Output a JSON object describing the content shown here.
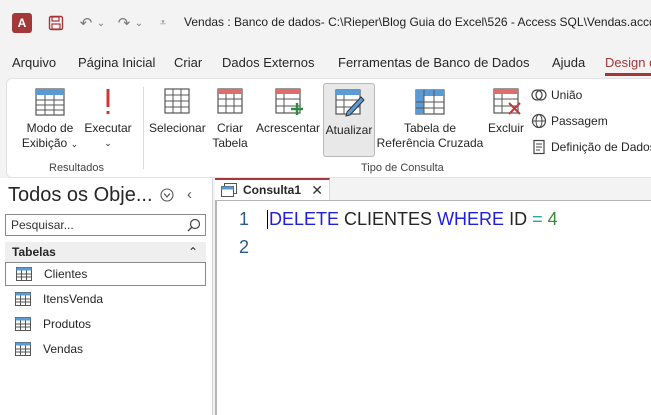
{
  "window": {
    "title": "Vendas : Banco de dados- C:\\Rieper\\Blog Guia do Excel\\526 - Access SQL\\Vendas.accdb (",
    "app_icon_letter": "A"
  },
  "ribbon_tabs": [
    "Arquivo",
    "Página Inicial",
    "Criar",
    "Dados Externos",
    "Ferramentas de Banco de Dados",
    "Ajuda",
    "Design d"
  ],
  "ribbon": {
    "results": {
      "view_line1": "Modo de",
      "view_line2": "Exibição",
      "run_line1": "Executar",
      "group": "Resultados"
    },
    "query_type": {
      "select": "Selecionar",
      "make_table_line1": "Criar",
      "make_table_line2": "Tabela",
      "append": "Acrescentar",
      "update": "Atualizar",
      "crosstab_line1": "Tabela de",
      "crosstab_line2": "Referência Cruzada",
      "delete": "Excluir",
      "union": "União",
      "passthrough": "Passagem",
      "data_definition": "Definição de Dados",
      "group": "Tipo de Consulta"
    }
  },
  "nav_pane": {
    "title": "Todos os Obje...",
    "search_placeholder": "Pesquisar...",
    "section": "Tabelas",
    "items": [
      "Clientes",
      "ItensVenda",
      "Produtos",
      "Vendas"
    ],
    "selected_index": 0
  },
  "editor": {
    "tab_label": "Consulta1",
    "lines": [
      {
        "number": "1",
        "tokens": [
          {
            "text": "DELETE",
            "kind": "kw"
          },
          {
            "text": " CLIENTES ",
            "kind": "id"
          },
          {
            "text": "WHERE",
            "kind": "kw"
          },
          {
            "text": " ID ",
            "kind": "id"
          },
          {
            "text": "=",
            "kind": "op"
          },
          {
            "text": " 4",
            "kind": "num"
          }
        ]
      },
      {
        "number": "2",
        "tokens": []
      }
    ]
  },
  "colors": {
    "accent": "#a4373a",
    "keyword": "#1f1fd8",
    "operator": "#2aa3a3",
    "number": "#3a8a3a"
  }
}
